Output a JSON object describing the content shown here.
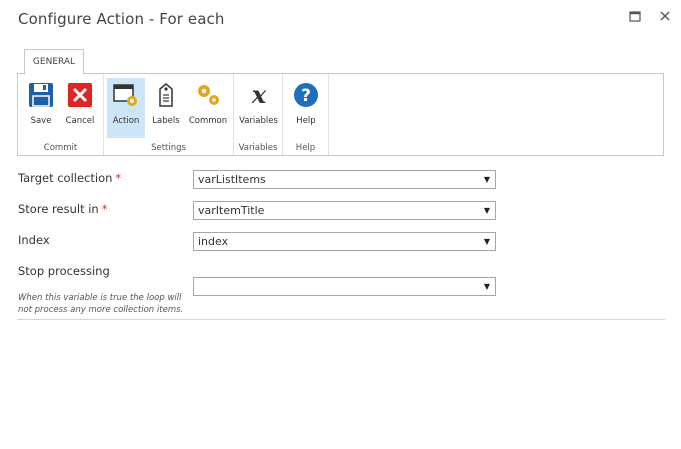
{
  "window": {
    "title": "Configure Action - For each"
  },
  "ribbon": {
    "tab_label": "GENERAL",
    "groups": [
      {
        "label": "Commit",
        "buttons": [
          {
            "label": "Save",
            "icon": "save-icon"
          },
          {
            "label": "Cancel",
            "icon": "cancel-icon"
          }
        ]
      },
      {
        "label": "Settings",
        "buttons": [
          {
            "label": "Action",
            "icon": "action-icon",
            "active": true
          },
          {
            "label": "Labels",
            "icon": "labels-icon"
          },
          {
            "label": "Common",
            "icon": "common-gears-icon"
          }
        ]
      },
      {
        "label": "Variables",
        "buttons": [
          {
            "label": "Variables",
            "icon": "variable-x-icon"
          }
        ]
      },
      {
        "label": "Help",
        "buttons": [
          {
            "label": "Help",
            "icon": "help-icon"
          }
        ]
      }
    ]
  },
  "form": {
    "target_collection": {
      "label": "Target collection",
      "required": "*",
      "value": "varListItems"
    },
    "store_result": {
      "label": "Store result in",
      "required": "*",
      "value": "varItemTitle"
    },
    "index": {
      "label": "Index",
      "value": "index"
    },
    "stop_processing": {
      "label": "Stop processing",
      "hint": "When this variable is true the loop will not process any more collection items.",
      "value": ""
    }
  },
  "colors": {
    "accent_active": "#cde6f7",
    "save_blue": "#1e5fa8",
    "cancel_red": "#e02424",
    "help_blue": "#1f6fbf",
    "required": "#c0392b"
  }
}
